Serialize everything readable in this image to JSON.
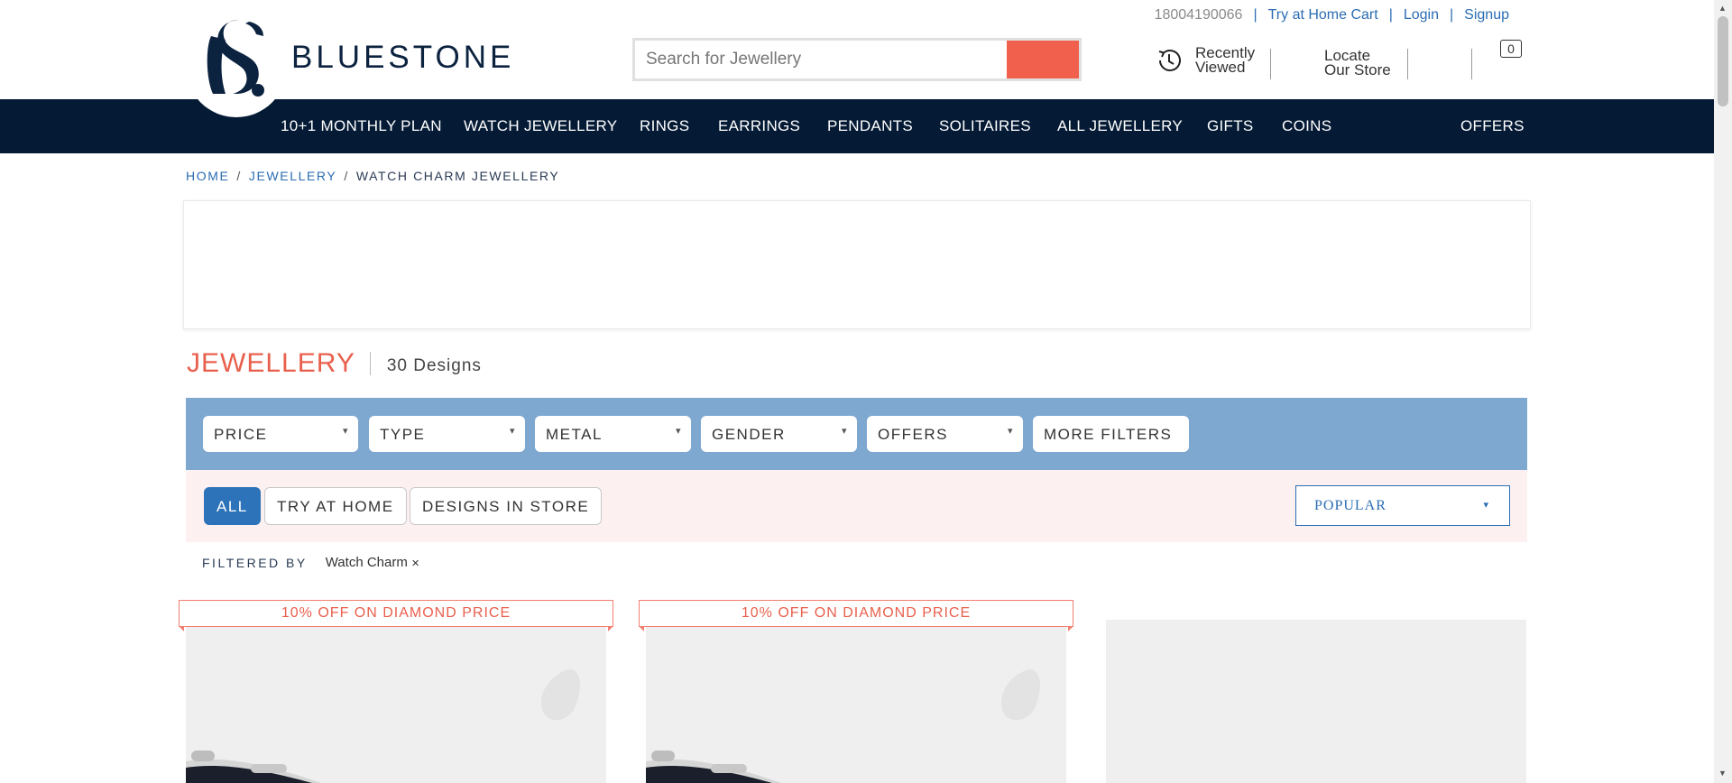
{
  "header": {
    "brand": "BLUESTONE",
    "phone": "18004190066",
    "try_home_cart": "Try at Home Cart",
    "login": "Login",
    "signup": "Signup",
    "search_placeholder": "Search for Jewellery",
    "recently_viewed": "Recently Viewed",
    "locate_store": "Locate Our Store",
    "cart_count": "0"
  },
  "nav": {
    "items": [
      "10+1 MONTHLY PLAN",
      "WATCH JEWELLERY",
      "RINGS",
      "EARRINGS",
      "PENDANTS",
      "SOLITAIRES",
      "ALL JEWELLERY",
      "GIFTS",
      "COINS"
    ],
    "offers": "OFFERS"
  },
  "breadcrumb": {
    "home": "HOME",
    "jewellery": "JEWELLERY",
    "current": "WATCH CHARM JEWELLERY",
    "separator": "/"
  },
  "listing": {
    "title": "JEWELLERY",
    "count": "30 Designs"
  },
  "filters": [
    "PRICE",
    "TYPE",
    "METAL",
    "GENDER",
    "OFFERS"
  ],
  "more_filters": "MORE FILTERS",
  "quick_filters": {
    "all": "ALL",
    "try_at_home": "TRY AT HOME",
    "designs_in_store": "DESIGNS IN STORE"
  },
  "sort": {
    "selected": "POPULAR"
  },
  "filtered_by": {
    "label": "FILTERED BY",
    "chip": "Watch Charm"
  },
  "products": [
    {
      "ribbon": "10% OFF ON DIAMOND PRICE"
    },
    {
      "ribbon": "10% OFF ON DIAMOND PRICE"
    },
    {
      "ribbon": ""
    }
  ],
  "colors": {
    "navy": "#051b35",
    "accent": "#f0604d",
    "link": "#2c6db3",
    "filter_bar": "#7fa8d1",
    "sort_bar": "#fdf0f1"
  },
  "icons": {
    "chevron": "chevron-down-icon",
    "history": "history-icon",
    "close": "close-icon"
  }
}
